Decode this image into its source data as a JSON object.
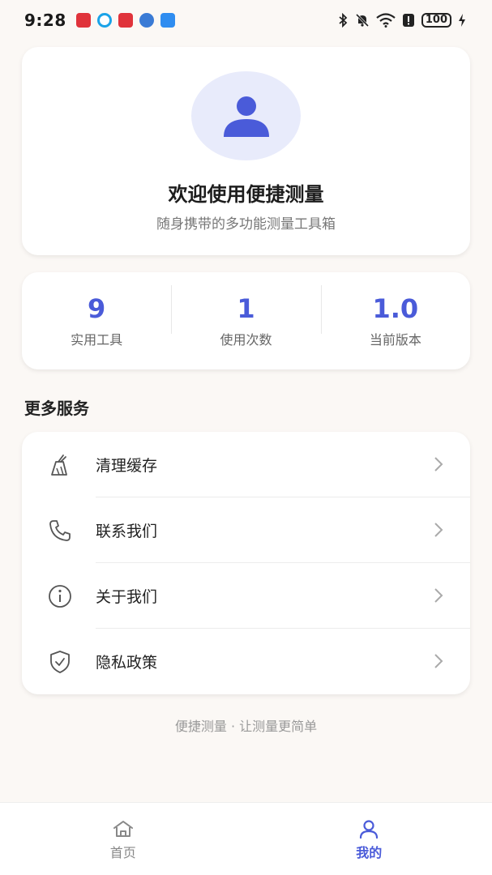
{
  "status_bar": {
    "time": "9:28",
    "battery": "100",
    "notification_icons": [
      {
        "name": "huawei-app-icon",
        "color": "#e0333b"
      },
      {
        "name": "browser-app-icon",
        "color": "#1aa3e8"
      },
      {
        "name": "huawei-app-icon-2",
        "color": "#e0333b"
      },
      {
        "name": "game-app-icon",
        "color": "#3a7bd5"
      },
      {
        "name": "cloud-app-icon",
        "color": "#2f8df0"
      }
    ]
  },
  "profile": {
    "title": "欢迎使用便捷测量",
    "subtitle": "随身携带的多功能测量工具箱"
  },
  "stats": [
    {
      "value": "9",
      "label": "实用工具"
    },
    {
      "value": "1",
      "label": "使用次数"
    },
    {
      "value": "1.0",
      "label": "当前版本"
    }
  ],
  "section_title": "更多服务",
  "menu": [
    {
      "label": "清理缓存",
      "icon": "broom-icon"
    },
    {
      "label": "联系我们",
      "icon": "phone-icon"
    },
    {
      "label": "关于我们",
      "icon": "info-icon"
    },
    {
      "label": "隐私政策",
      "icon": "shield-icon"
    }
  ],
  "footer": "便捷测量 · 让测量更简单",
  "nav": {
    "home": "首页",
    "mine": "我的"
  },
  "colors": {
    "accent": "#4a5bd9",
    "avatar_bg": "#e8ebfb",
    "background": "#fbf8f5"
  }
}
